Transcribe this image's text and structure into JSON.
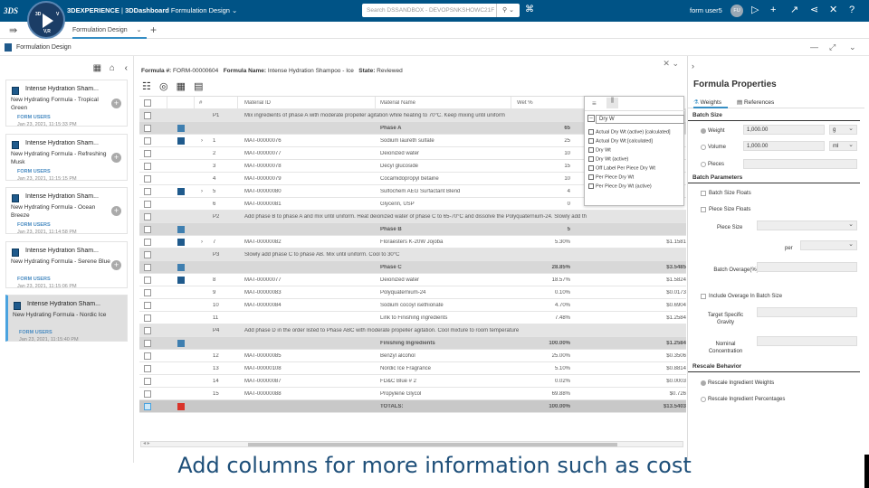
{
  "topbar": {
    "logo": "3DS",
    "compass_labels": [
      "3D",
      "V",
      "V,R"
    ],
    "brand": "3DEXPERIENCE",
    "app": "3DDashboard",
    "title": "Formulation Design",
    "search_placeholder": "Search DSSANDBOX - DEVOPSNKSHOWC21F",
    "user": "form user5",
    "avatar": "FU",
    "icons": [
      "compass-icon",
      "tag-icon",
      "share-icon",
      "plus-icon",
      "arrow-icon",
      "network-icon",
      "tools-icon",
      "help-icon"
    ]
  },
  "tabs": {
    "active": "Formulation Design",
    "add": "+"
  },
  "app_header": {
    "title": "Formulation Design"
  },
  "left_panel": {
    "cards": [
      {
        "title": "Intense Hydration Sham...",
        "desc": "New Hydrating Formula - Tropical Green",
        "owner": "FORM USERS",
        "date": "Jan 23, 2021, 11:15:33 PM"
      },
      {
        "title": "Intense Hydration Sham...",
        "desc": "New Hydrating Formula - Refreshing Musk",
        "owner": "FORM USERS",
        "date": "Jan 23, 2021, 11:15:15 PM"
      },
      {
        "title": "Intense Hydration Sham...",
        "desc": "New Hydrating Formula - Ocean Breeze",
        "owner": "FORM USERS",
        "date": "Jan 23, 2021, 11:14:58 PM"
      },
      {
        "title": "Intense Hydration Sham...",
        "desc": "New Hydrating Formula - Serene Blue",
        "owner": "FORM USERS",
        "date": "Jan 23, 2021, 11:15:06 PM"
      },
      {
        "title": "Intense Hydration Sham...",
        "desc": "New Hydrating Formula - Nordic Ice",
        "owner": "FORM USERS",
        "date": "Jan 23, 2021, 11:15:40 PM"
      }
    ]
  },
  "formula": {
    "number_label": "Formula #:",
    "number": "FORM-00000604",
    "name_label": "Formula Name:",
    "name": "Intense Hydration Shampoo - Ice",
    "state_label": "State:",
    "state": "Reviewed"
  },
  "grid": {
    "headers": {
      "num": "#",
      "id": "Material ID",
      "name": "Material Name",
      "wt": "Wet %"
    },
    "rows": [
      {
        "type": "phase",
        "num": "P1",
        "text": "Mix ingredients of phase A with moderate propeller agitation while heating to 70°C. Keep mixing until uniform"
      },
      {
        "type": "sum",
        "name": "Phase A",
        "pct": "65",
        "cost": ""
      },
      {
        "type": "item",
        "num": "1",
        "id": "MAT-00000076",
        "name": "Sodium laureth sulfate",
        "pct": "25",
        "cost": "",
        "expand": true,
        "icon": true
      },
      {
        "type": "item",
        "num": "2",
        "id": "MAT-00000077",
        "name": "Deionized water",
        "pct": "10",
        "cost": ""
      },
      {
        "type": "item",
        "num": "3",
        "id": "MAT-00000078",
        "name": "Decyl glucoside",
        "pct": "15",
        "cost": ""
      },
      {
        "type": "item",
        "num": "4",
        "id": "MAT-00000079",
        "name": "Cocamidopropyl betaine",
        "pct": "10",
        "cost": ""
      },
      {
        "type": "item",
        "num": "5",
        "id": "MAT-00000080",
        "name": "Sulfochem AEG Surfactant Blend",
        "pct": "4",
        "cost": "",
        "expand": true,
        "icon": true
      },
      {
        "type": "item",
        "num": "6",
        "id": "MAT-00000081",
        "name": "Glycerin, USP",
        "pct": "0",
        "cost": ""
      },
      {
        "type": "phase",
        "num": "P2",
        "text": "Add phase B to phase A and mix until uniform. Heat deionized water of phase C to 65-70°C and dissolve the Polyquaternium-24. Slowly add th"
      },
      {
        "type": "sum",
        "name": "Phase B",
        "pct": "5",
        "cost": ""
      },
      {
        "type": "item",
        "num": "7",
        "id": "MAT-00000082",
        "name": "Floraesters K-20W Jojoba",
        "pct": "5.30%",
        "cost": "$1.1581",
        "expand": true,
        "icon": true
      },
      {
        "type": "phase",
        "num": "P3",
        "text": "Slowly add phase C to phase AB. Mix until uniform. Cool to 30°C"
      },
      {
        "type": "sum",
        "name": "Phase C",
        "pct": "28.85%",
        "cost": "$3.5485"
      },
      {
        "type": "item",
        "num": "8",
        "id": "MAT-00000077",
        "name": "Deionized water",
        "pct": "18.57%",
        "cost": "$1.5824",
        "icon": true
      },
      {
        "type": "item",
        "num": "9",
        "id": "MAT-00000083",
        "name": "Polyquaternium-24",
        "pct": "0.10%",
        "cost": "$0.0173"
      },
      {
        "type": "item",
        "num": "10",
        "id": "MAT-00000084",
        "name": "Sodium cocoyl isethionate",
        "pct": "4.70%",
        "cost": "$0.6904"
      },
      {
        "type": "item",
        "num": "11",
        "id": "",
        "name": "Link to Finishing ingredients",
        "pct": "7.48%",
        "cost": "$1.2584"
      },
      {
        "type": "phase",
        "num": "P4",
        "text": "Add phase D in the order listed to Phase ABC with moderate propeller agitation. Cool mixture to room temperature"
      },
      {
        "type": "sum",
        "name": "Finishing Ingredients",
        "pct": "100.00%",
        "cost": "$1.2584"
      },
      {
        "type": "item",
        "num": "12",
        "id": "MAT-00000085",
        "name": "Benzyl alcohol",
        "pct": "25.00%",
        "cost": "$0.3506"
      },
      {
        "type": "item",
        "num": "13",
        "id": "MAT-00000108",
        "name": "Nordic Ice Fragrance",
        "pct": "5.10%",
        "cost": "$0.8814"
      },
      {
        "type": "item",
        "num": "14",
        "id": "MAT-00000087",
        "name": "FD&C Blue # 2",
        "pct": "0.02%",
        "cost": "$0.0003"
      },
      {
        "type": "item",
        "num": "15",
        "id": "MAT-00000088",
        "name": "Propylene Glycol",
        "pct": "69.88%",
        "cost": "$0.726"
      },
      {
        "type": "total",
        "name": "TOTALS:",
        "pct": "100.00%",
        "cost": "$13.5403"
      }
    ]
  },
  "column_popup": {
    "filter_value": "Dry W",
    "options": [
      "Actual Dry Wt (active) [calculated]",
      "Actual Dry Wt [calculated]",
      "Dry Wt",
      "Dry Wt (active)",
      "Off Label Per Piece Dry Wt",
      "Per Piece Dry Wt",
      "Per Piece Dry Wt (active)"
    ]
  },
  "right_panel": {
    "title": "Formula Properties",
    "tab_weights": "Weights",
    "tab_references": "References",
    "batch_size": "Batch Size",
    "weight_label": "Weight",
    "weight_value": "1,000.00",
    "weight_unit": "g",
    "volume_label": "Volume",
    "volume_value": "1,000.00",
    "volume_unit": "ml",
    "pieces_label": "Pieces",
    "batch_params": "Batch Parameters",
    "batch_size_floats": "Batch Size Floats",
    "piece_size_floats": "Piece Size Floats",
    "piece_size": "Piece Size",
    "per": "per",
    "batch_overage": "Batch Overage(%)",
    "include_overage": "Include Overage In Batch Size",
    "target_sg": "Target Specific Gravity",
    "nominal_conc": "Nominal Concentration",
    "rescale": "Rescale Behavior",
    "rescale_weights": "Rescale Ingredient Weights",
    "rescale_pct": "Rescale Ingredient Percentages"
  },
  "caption": "Add columns for more information such as cost"
}
